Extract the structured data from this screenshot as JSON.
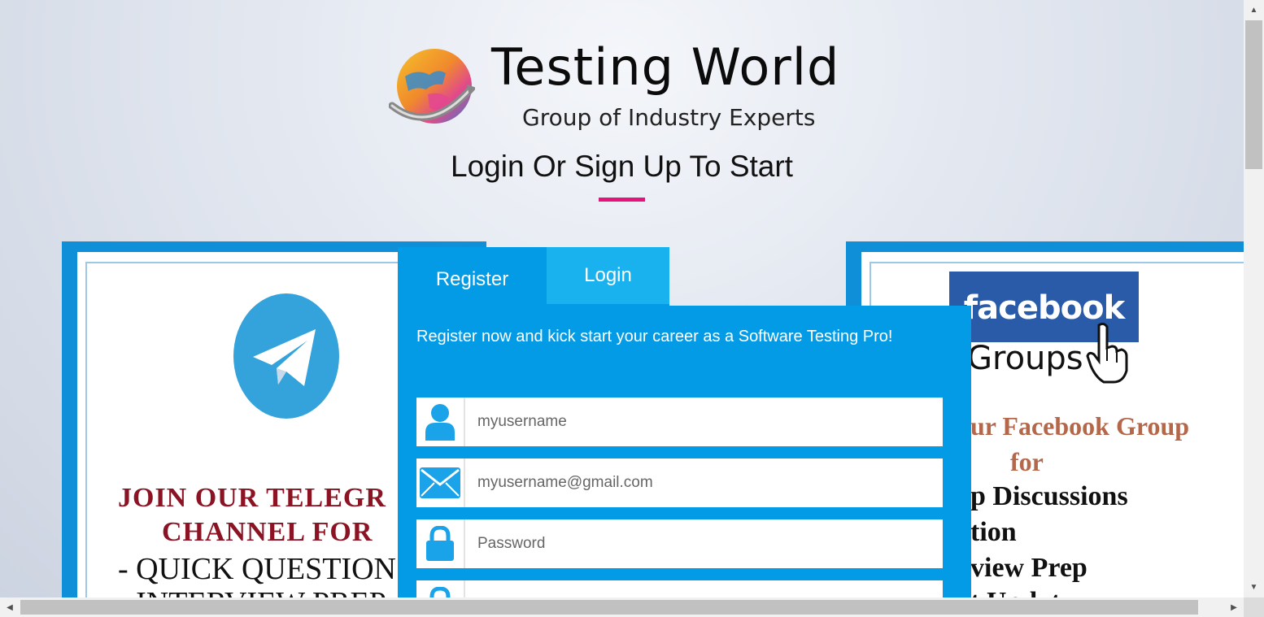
{
  "header": {
    "logo_title": "Testing World",
    "logo_subtitle": "Group of Industry Experts",
    "page_title": "Login Or Sign Up To Start",
    "accent_color": "#e6137a"
  },
  "telegram_card": {
    "line1": "JOIN OUR TELEGR",
    "line2": "CHANNEL  FOR",
    "line3": "- QUICK QUESTION",
    "line4": "- INTERVIEW PREP"
  },
  "facebook_card": {
    "badge": "facebook",
    "groups": "Groups",
    "line1": "ur Facebook Group",
    "line2": "for",
    "line3": "p Discussions",
    "line4": "tion",
    "line5": "view Prep",
    "line6": "t Updates"
  },
  "tabs": {
    "register_label": "Register",
    "login_label": "Login",
    "active": "Register"
  },
  "form": {
    "intro": "Register now and kick start your career as a Software Testing Pro!",
    "username_placeholder": "myusername",
    "email_placeholder": "myusername@gmail.com",
    "password_placeholder": "Password",
    "confirm_placeholder": "",
    "panel_color": "#039be5"
  },
  "icons": [
    "user-icon",
    "mail-icon",
    "lock-icon",
    "lock-icon"
  ]
}
